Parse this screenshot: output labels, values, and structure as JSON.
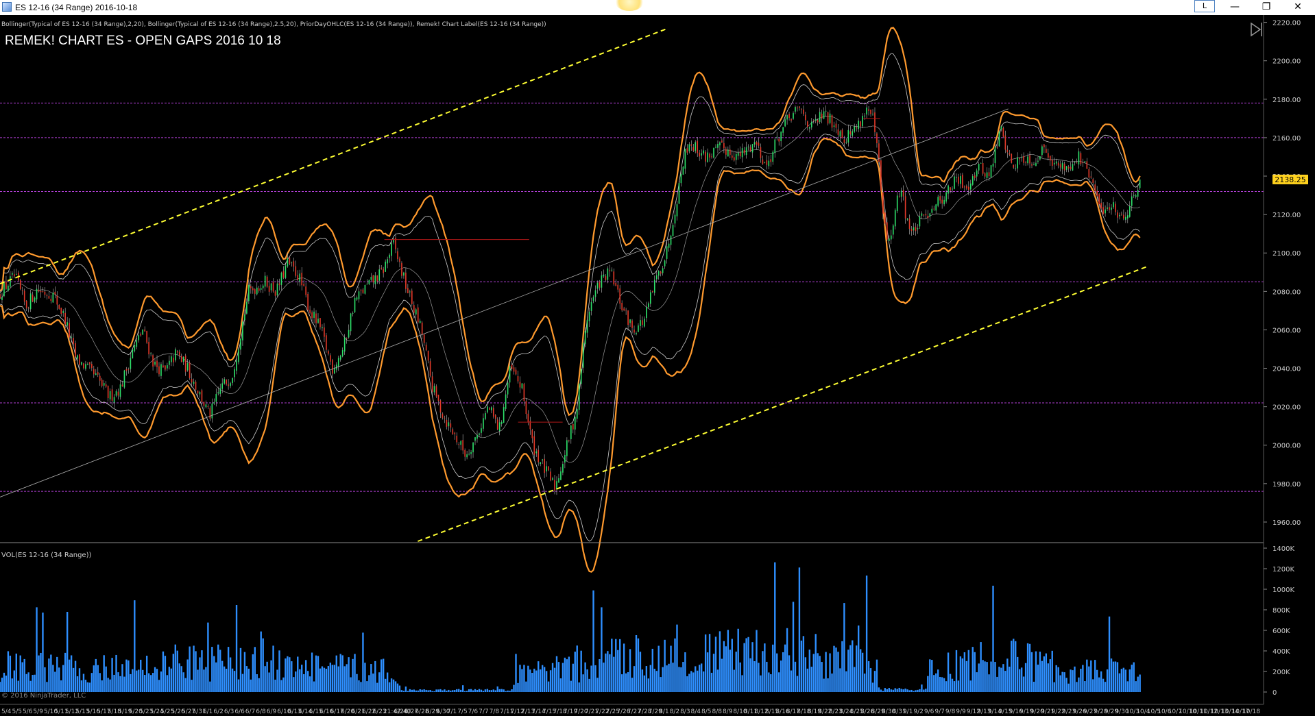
{
  "window": {
    "title": "ES 12-16 (34 Range)  2016-10-18",
    "l_button": "L",
    "minimize": "—",
    "restore": "❐",
    "close": "✕"
  },
  "indicator_label": "Bollinger(Typical of ES 12-16 (34 Range),2,20), Bollinger(Typical of ES 12-16 (34 Range),2.5,20), PriorDayOHLC(ES 12-16 (34 Range)), Remek! Chart Label(ES 12-16 (34 Range))",
  "chart_label": "REMEK! CHART ES - OPEN GAPS 2016 10 18",
  "volume_label": "VOL(ES 12-16 (34 Range))",
  "copyright": "© 2016 NinjaTrader, LLC",
  "price_marker": "2138.25",
  "colors": {
    "background": "#000000",
    "gap_line": "#b23fd6",
    "channel": "#ffff33",
    "bollinger_outer": "#ff9a2e",
    "bollinger_inner": "#cfcfcf",
    "up_candle": "#2ee06a",
    "down_candle": "#e23a2a",
    "volume": "#2e8fff",
    "price_marker_bg": "#ffd21e"
  },
  "chart_data": [
    {
      "type": "candlestick",
      "title": "REMEK! CHART ES - OPEN GAPS 2016 10 18",
      "ylim": [
        1950,
        2222
      ],
      "y_ticks": [
        "2220.00",
        "2200.00",
        "2180.00",
        "2160.00",
        "2140.00",
        "2120.00",
        "2100.00",
        "2080.00",
        "2060.00",
        "2040.00",
        "2020.00",
        "2000.00",
        "1980.00",
        "1960.00"
      ],
      "x_tick_labels": [
        "5/4",
        "5/5",
        "5/6",
        "5/9",
        "5/10",
        "5/11",
        "5/12",
        "5/13",
        "5/16",
        "5/17",
        "5/18",
        "5/19",
        "5/20",
        "5/23",
        "5/24",
        "5/25",
        "5/26",
        "5/27",
        "5/31",
        "6/1",
        "6/2",
        "6/3",
        "6/6",
        "6/7",
        "6/8",
        "6/9",
        "6/10",
        "6/13",
        "6/14",
        "6/15",
        "6/16",
        "6/17",
        "6/20",
        "6/21",
        "6/22",
        "6/23",
        "21:42:40",
        "6/24",
        "6/27",
        "6/28",
        "6/29",
        "6/30",
        "7/1",
        "7/5",
        "7/6",
        "7/7",
        "7/8",
        "7/11",
        "7/12",
        "7/13",
        "7/14",
        "7/15",
        "7/18",
        "7/19",
        "7/20",
        "7/21",
        "7/22",
        "7/25",
        "7/26",
        "7/27",
        "7/28",
        "7/29",
        "8/1",
        "8/2",
        "8/3",
        "8/4",
        "8/5",
        "8/8",
        "8/9",
        "8/10",
        "8/11",
        "8/12",
        "8/15",
        "8/16",
        "8/17",
        "8/18",
        "8/19",
        "8/22",
        "8/23",
        "8/24",
        "8/25",
        "8/26",
        "8/29",
        "8/30",
        "8/31",
        "9/1",
        "9/2",
        "9/6",
        "9/7",
        "9/8",
        "9/9",
        "9/12",
        "9/13",
        "9/14",
        "9/15",
        "9/16",
        "9/19",
        "9/20",
        "9/21",
        "9/22",
        "9/23",
        "9/26",
        "9/27",
        "9/28",
        "9/29",
        "9/30",
        "10/3",
        "10/4",
        "10/5",
        "10/6",
        "10/7",
        "10/10",
        "10/11",
        "10/12",
        "10/13",
        "10/14",
        "10/17",
        "10/18"
      ],
      "open_gap_levels": [
        2178,
        2160,
        2132,
        2085,
        2022,
        1976
      ],
      "channel_upper": [
        [
          0,
          2084
        ],
        [
          0.6,
          2217
        ]
      ],
      "channel_lower": [
        [
          0.375,
          1950
        ],
        [
          1.03,
          2093
        ]
      ],
      "regression_line": [
        [
          0,
          1973
        ],
        [
          0.905,
          2175
        ]
      ],
      "prior_day_levels": [
        {
          "x": [
            0.345,
            0.475
          ],
          "y": 2107,
          "color": "#b01818"
        },
        {
          "x": [
            0.465,
            0.505
          ],
          "y": 2012,
          "color": "#b01818"
        },
        {
          "x": [
            0.775,
            0.79
          ],
          "y": 2170,
          "color": "#b01818"
        }
      ],
      "price_path": [
        [
          0.0,
          2078
        ],
        [
          0.015,
          2088
        ],
        [
          0.025,
          2072
        ],
        [
          0.035,
          2081
        ],
        [
          0.05,
          2078
        ],
        [
          0.06,
          2066
        ],
        [
          0.07,
          2045
        ],
        [
          0.08,
          2040
        ],
        [
          0.09,
          2034
        ],
        [
          0.1,
          2025
        ],
        [
          0.11,
          2030
        ],
        [
          0.12,
          2048
        ],
        [
          0.13,
          2060
        ],
        [
          0.14,
          2042
        ],
        [
          0.15,
          2038
        ],
        [
          0.16,
          2048
        ],
        [
          0.17,
          2040
        ],
        [
          0.18,
          2028
        ],
        [
          0.19,
          2015
        ],
        [
          0.2,
          2030
        ],
        [
          0.21,
          2036
        ],
        [
          0.215,
          2050
        ],
        [
          0.225,
          2080
        ],
        [
          0.24,
          2085
        ],
        [
          0.25,
          2080
        ],
        [
          0.26,
          2095
        ],
        [
          0.27,
          2088
        ],
        [
          0.28,
          2070
        ],
        [
          0.29,
          2060
        ],
        [
          0.3,
          2040
        ],
        [
          0.31,
          2050
        ],
        [
          0.32,
          2075
        ],
        [
          0.33,
          2082
        ],
        [
          0.345,
          2090
        ],
        [
          0.355,
          2105
        ],
        [
          0.365,
          2085
        ],
        [
          0.38,
          2060
        ],
        [
          0.39,
          2030
        ],
        [
          0.4,
          2015
        ],
        [
          0.41,
          2005
        ],
        [
          0.42,
          1995
        ],
        [
          0.43,
          2005
        ],
        [
          0.44,
          2020
        ],
        [
          0.45,
          2008
        ],
        [
          0.46,
          2040
        ],
        [
          0.47,
          2030
        ],
        [
          0.475,
          2015
        ],
        [
          0.48,
          2000
        ],
        [
          0.49,
          1988
        ],
        [
          0.5,
          1978
        ],
        [
          0.51,
          1998
        ],
        [
          0.52,
          2020
        ],
        [
          0.525,
          2050
        ],
        [
          0.53,
          2070
        ],
        [
          0.54,
          2085
        ],
        [
          0.55,
          2090
        ],
        [
          0.56,
          2072
        ],
        [
          0.57,
          2060
        ],
        [
          0.58,
          2065
        ],
        [
          0.59,
          2085
        ],
        [
          0.6,
          2100
        ],
        [
          0.605,
          2115
        ],
        [
          0.61,
          2130
        ],
        [
          0.615,
          2148
        ],
        [
          0.62,
          2158
        ],
        [
          0.635,
          2150
        ],
        [
          0.65,
          2155
        ],
        [
          0.665,
          2150
        ],
        [
          0.68,
          2158
        ],
        [
          0.69,
          2145
        ],
        [
          0.7,
          2160
        ],
        [
          0.71,
          2170
        ],
        [
          0.72,
          2175
        ],
        [
          0.73,
          2165
        ],
        [
          0.74,
          2172
        ],
        [
          0.75,
          2168
        ],
        [
          0.76,
          2160
        ],
        [
          0.77,
          2165
        ],
        [
          0.78,
          2175
        ],
        [
          0.785,
          2170
        ],
        [
          0.79,
          2150
        ],
        [
          0.795,
          2115
        ],
        [
          0.8,
          2105
        ],
        [
          0.805,
          2120
        ],
        [
          0.81,
          2135
        ],
        [
          0.815,
          2120
        ],
        [
          0.82,
          2110
        ],
        [
          0.83,
          2118
        ],
        [
          0.84,
          2125
        ],
        [
          0.85,
          2130
        ],
        [
          0.86,
          2138
        ],
        [
          0.87,
          2135
        ],
        [
          0.88,
          2145
        ],
        [
          0.89,
          2140
        ],
        [
          0.9,
          2165
        ],
        [
          0.905,
          2155
        ],
        [
          0.91,
          2145
        ],
        [
          0.92,
          2150
        ],
        [
          0.93,
          2148
        ],
        [
          0.94,
          2155
        ],
        [
          0.95,
          2145
        ],
        [
          0.96,
          2145
        ],
        [
          0.97,
          2150
        ],
        [
          0.98,
          2140
        ],
        [
          0.99,
          2122
        ],
        [
          1.0,
          2125
        ],
        [
          1.01,
          2118
        ],
        [
          1.02,
          2130
        ],
        [
          1.025,
          2138.25
        ]
      ]
    },
    {
      "type": "bar",
      "title": "VOL(ES 12-16 (34 Range))",
      "ylim": [
        0,
        1400000
      ],
      "y_ticks": [
        "1400K",
        "1200K",
        "1000K",
        "800K",
        "600K",
        "400K",
        "200K",
        "0"
      ],
      "volume_regime": [
        [
          0.0,
          350
        ],
        [
          0.1,
          320
        ],
        [
          0.2,
          420
        ],
        [
          0.28,
          350
        ],
        [
          0.35,
          300
        ],
        [
          0.36,
          30
        ],
        [
          0.46,
          25
        ],
        [
          0.465,
          250
        ],
        [
          0.52,
          350
        ],
        [
          0.56,
          500
        ],
        [
          0.64,
          520
        ],
        [
          0.7,
          560
        ],
        [
          0.78,
          420
        ],
        [
          0.79,
          40
        ],
        [
          0.83,
          30
        ],
        [
          0.835,
          320
        ],
        [
          0.9,
          480
        ],
        [
          0.96,
          300
        ],
        [
          1.025,
          280
        ]
      ]
    }
  ]
}
